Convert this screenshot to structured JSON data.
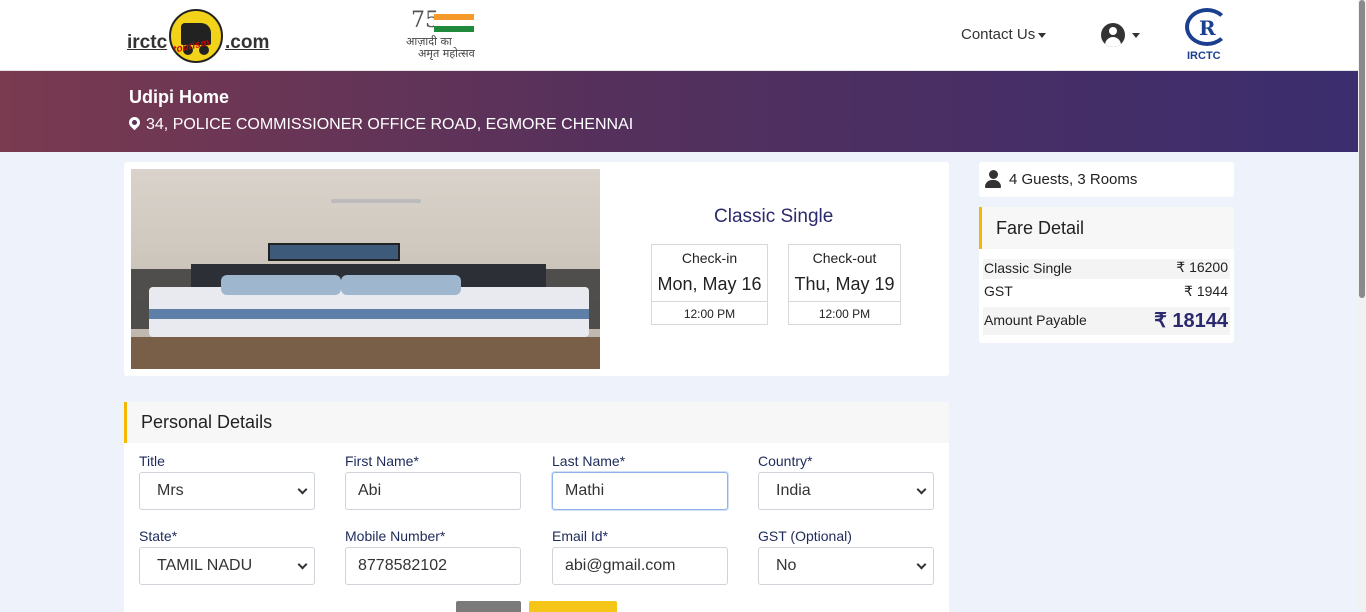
{
  "header": {
    "logo_left": "irctc",
    "logo_right": ".com",
    "logo_script": "tourism",
    "azadi_num": "75",
    "azadi_line1": "आज़ादी का",
    "azadi_line2": "अमृत महोत्सव",
    "contact_label": "Contact Us",
    "irctc_logo_text": "IRCTC",
    "irctc_logo_mark": "R"
  },
  "hotel": {
    "name": "Udipi Home",
    "address": "34, POLICE COMMISSIONER OFFICE ROAD, EGMORE CHENNAI"
  },
  "room": {
    "type": "Classic Single",
    "checkin_label": "Check-in",
    "checkin_date": "Mon, May 16",
    "checkin_time": "12:00 PM",
    "checkout_label": "Check-out",
    "checkout_date": "Thu, May 19",
    "checkout_time": "12:00 PM"
  },
  "guests": "4 Guests, 3 Rooms",
  "fare": {
    "title": "Fare Detail",
    "rows": [
      {
        "label": "Classic Single",
        "value": "₹ 16200"
      },
      {
        "label": "GST",
        "value": "₹ 1944"
      },
      {
        "label": "Amount Payable",
        "value": "₹ 18144"
      }
    ]
  },
  "personal": {
    "title": "Personal Details",
    "title_field": {
      "label": "Title",
      "value": "Mrs"
    },
    "first_name": {
      "label": "First Name*",
      "value": "Abi"
    },
    "last_name": {
      "label": "Last Name*",
      "value": "Mathi"
    },
    "country": {
      "label": "Country*",
      "value": "India"
    },
    "state": {
      "label": "State*",
      "value": "TAMIL NADU"
    },
    "mobile": {
      "label": "Mobile Number*",
      "value": "8778582102"
    },
    "email": {
      "label": "Email Id*",
      "value": "abi@gmail.com"
    },
    "gst": {
      "label": "GST (Optional)",
      "value": "No"
    }
  },
  "colors": {
    "accent": "#f5b800",
    "brand_navy": "#2b2a6e",
    "banner_start": "#7a3a50",
    "banner_end": "#3b2d6e"
  },
  "icons": [
    "map-pin-icon",
    "user-circle-icon",
    "user-icon",
    "chevron-down-icon"
  ]
}
